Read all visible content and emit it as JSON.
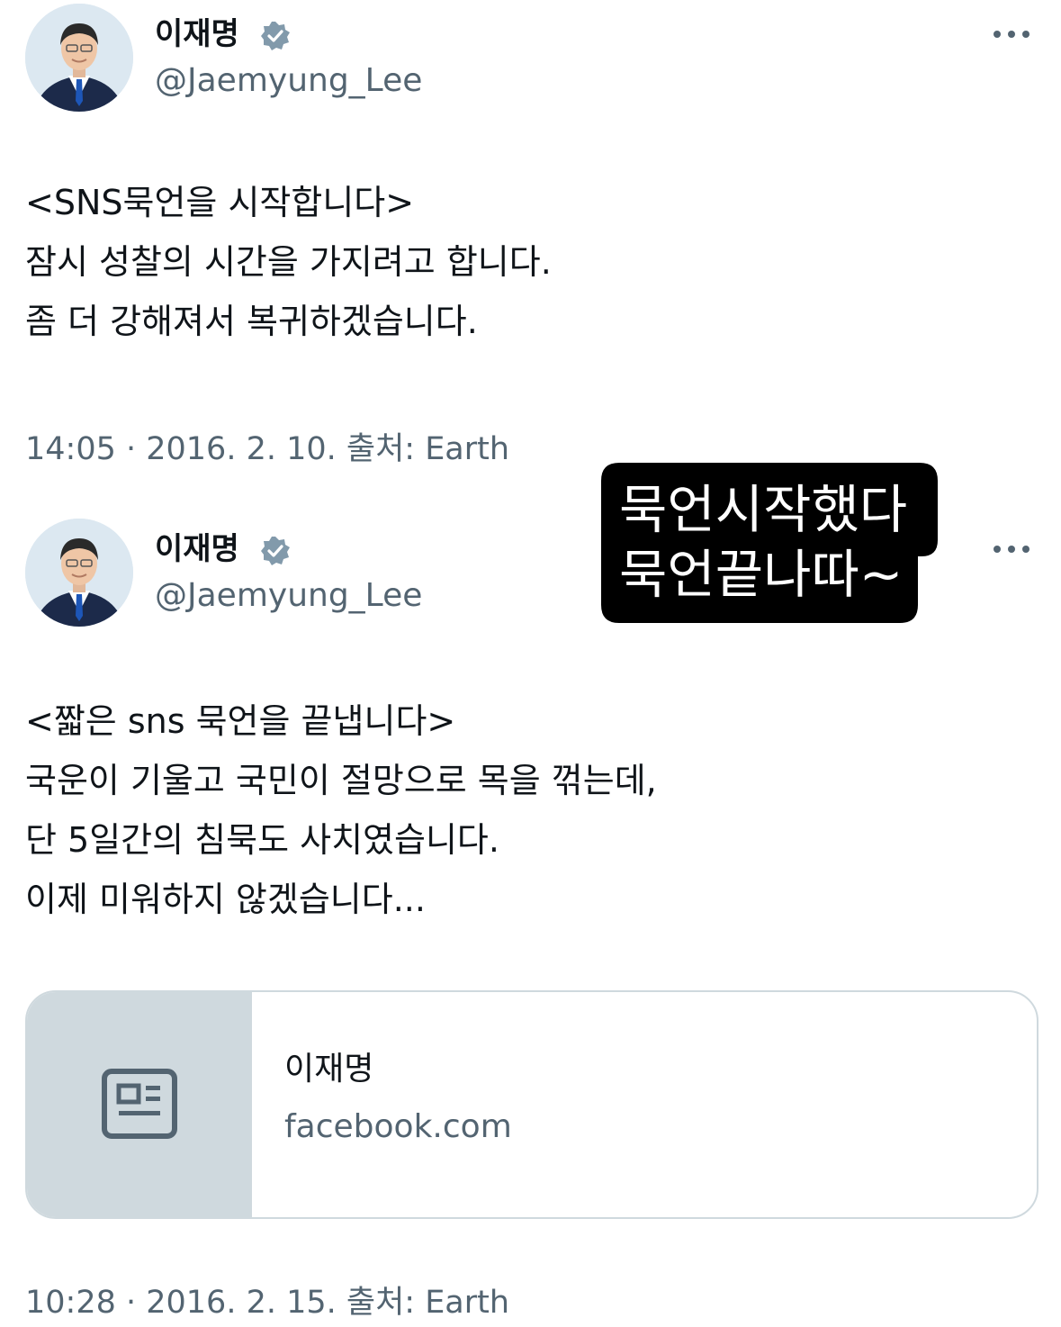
{
  "tweets": [
    {
      "author": {
        "display_name": "이재명",
        "handle": "@Jaemyung_Lee",
        "verified": true
      },
      "body": [
        "<SNS묵언을 시작합니다>",
        "잠시 성찰의 시간을 가지려고 합니다.",
        "좀 더 강해져서 복귀하겠습니다."
      ],
      "timestamp": "14:05 · 2016. 2. 10. 출처: Earth"
    },
    {
      "author": {
        "display_name": "이재명",
        "handle": "@Jaemyung_Lee",
        "verified": true
      },
      "body": [
        "<짧은 sns 묵언을 끝냅니다>",
        "국운이 기울고 국민이 절망으로 목을 꺾는데,",
        "단 5일간의 침묵도 사치였습니다.",
        "이제 미워하지 않겠습니다..."
      ],
      "link_card": {
        "title": "이재명",
        "domain": "facebook.com"
      },
      "timestamp": "10:28 · 2016. 2. 15. 출처: Earth"
    }
  ],
  "sticker": {
    "lines": [
      "묵언시작했다",
      "묵언끝나따~"
    ]
  },
  "icons": {
    "verified": "verified-badge-icon",
    "more": "more-options-icon",
    "card": "article-icon"
  },
  "colors": {
    "text": "#0f1419",
    "secondary": "#536471",
    "verified_badge": "#829aab",
    "card_border": "#cfd9de",
    "card_thumb": "#cfd9de",
    "sticker_bg": "#000000"
  }
}
